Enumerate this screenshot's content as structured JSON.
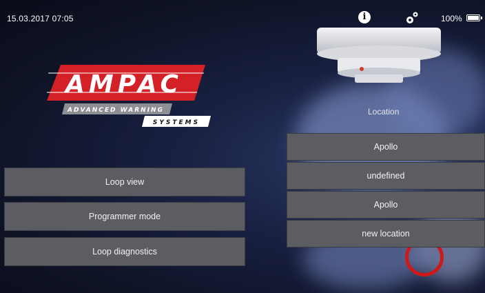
{
  "status_bar": {
    "datetime": "15.03.2017 07:05",
    "info_icon": "info-icon",
    "settings_icon": "gear-icon",
    "battery_percent": "100%",
    "battery_level": 1.0
  },
  "logo": {
    "wordmark": "AMPAC",
    "tagline_1": "ADVANCED WARNING",
    "tagline_2": "SYSTEMS",
    "brand_red": "#d42027"
  },
  "menu": {
    "items": [
      {
        "label": "Loop view"
      },
      {
        "label": "Programmer mode"
      },
      {
        "label": "Loop diagnostics"
      }
    ]
  },
  "location_panel": {
    "title": "Location",
    "options": [
      {
        "label": "Apollo"
      },
      {
        "label": "undefined"
      },
      {
        "label": "Apollo"
      },
      {
        "label": "new location"
      }
    ]
  },
  "colors": {
    "button_bg": "#5b5d63",
    "accent_red": "#d01818"
  }
}
